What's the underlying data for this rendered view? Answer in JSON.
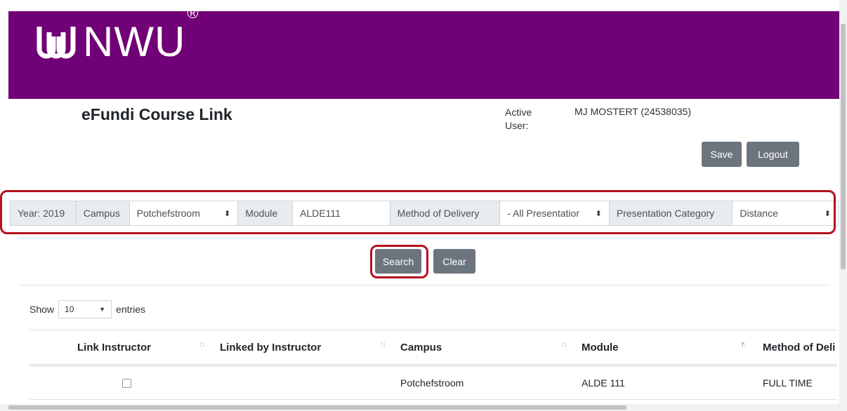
{
  "header": {
    "brand": "NWU",
    "brand_mark": "®",
    "page_title": "eFundi Course Link",
    "active_user_label": "Active User:",
    "active_user_value": "MJ MOSTERT (24538035)",
    "save_label": "Save",
    "logout_label": "Logout",
    "banner_color": "#700176"
  },
  "filters": {
    "year_label": "Year: 2019",
    "campus_label": "Campus",
    "campus_value": "Potchefstroom",
    "module_label": "Module",
    "module_value": "ALDE111",
    "method_label": "Method of Delivery",
    "method_value": "- All Presentatior",
    "category_label": "Presentation Category",
    "category_value": "Distance"
  },
  "actions": {
    "search_label": "Search",
    "clear_label": "Clear"
  },
  "entries": {
    "show_label": "Show",
    "value": "10",
    "suffix": "entries"
  },
  "table": {
    "columns": [
      "Link Instructor",
      "Linked by Instructor",
      "Campus",
      "Module",
      "Method of Deli"
    ],
    "rows": [
      {
        "link_instructor": false,
        "linked_by_instructor": "",
        "campus": "Potchefstroom",
        "module": "ALDE 111",
        "method": "FULL TIME"
      }
    ]
  },
  "icons": {
    "logo": "nwu-logo-icon",
    "sort": "sort-arrows-icon",
    "select": "select-arrows-icon",
    "dropdown": "chevron-down-icon"
  },
  "colors": {
    "brand": "#700176",
    "button": "#6c757d",
    "highlight": "#b3121e"
  }
}
